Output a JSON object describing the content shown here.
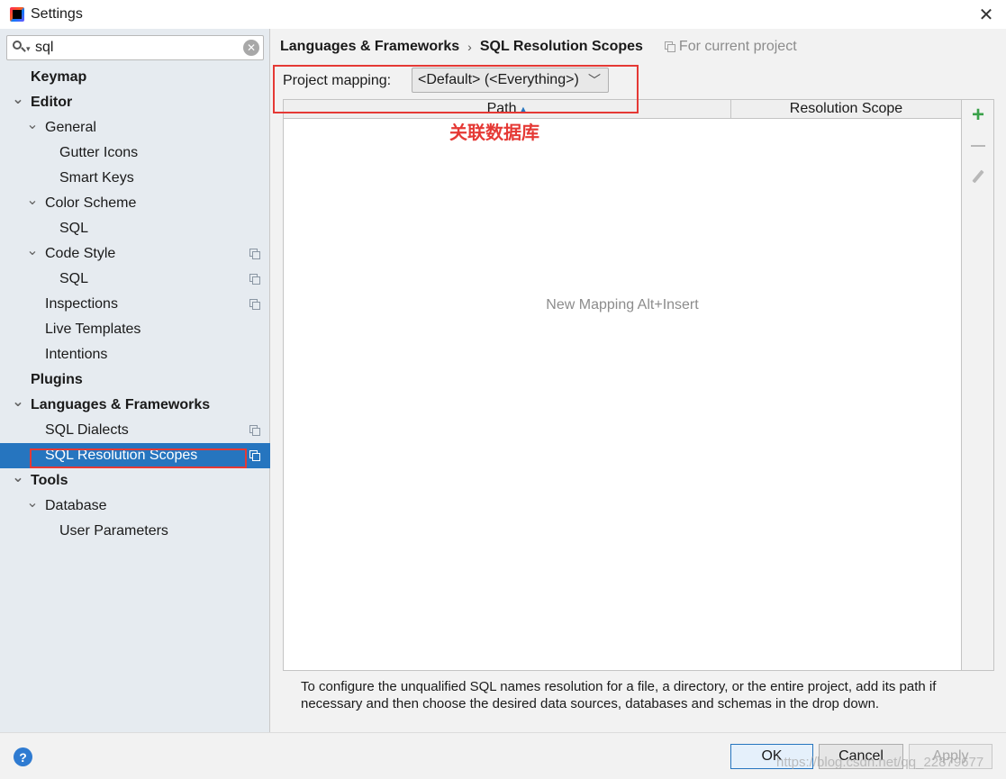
{
  "window": {
    "title": "Settings"
  },
  "search": {
    "value": "sql"
  },
  "tree": [
    {
      "label": "Keymap",
      "bold": true,
      "level": 0,
      "chevron": false,
      "copy": false
    },
    {
      "label": "Editor",
      "bold": true,
      "level": 0,
      "chevron": true,
      "copy": false
    },
    {
      "label": "General",
      "bold": false,
      "level": 1,
      "chevron": true,
      "copy": false
    },
    {
      "label": "Gutter Icons",
      "bold": false,
      "level": 2,
      "chevron": false,
      "copy": false
    },
    {
      "label": "Smart Keys",
      "bold": false,
      "level": 2,
      "chevron": false,
      "copy": false
    },
    {
      "label": "Color Scheme",
      "bold": false,
      "level": 1,
      "chevron": true,
      "copy": false
    },
    {
      "label": "SQL",
      "bold": false,
      "level": 2,
      "chevron": false,
      "copy": false
    },
    {
      "label": "Code Style",
      "bold": false,
      "level": 1,
      "chevron": true,
      "copy": true
    },
    {
      "label": "SQL",
      "bold": false,
      "level": 2,
      "chevron": false,
      "copy": true
    },
    {
      "label": "Inspections",
      "bold": false,
      "level": 1,
      "chevron": false,
      "copy": true
    },
    {
      "label": "Live Templates",
      "bold": false,
      "level": 1,
      "chevron": false,
      "copy": false
    },
    {
      "label": "Intentions",
      "bold": false,
      "level": 1,
      "chevron": false,
      "copy": false
    },
    {
      "label": "Plugins",
      "bold": true,
      "level": 0,
      "chevron": false,
      "copy": false
    },
    {
      "label": "Languages & Frameworks",
      "bold": true,
      "level": 0,
      "chevron": true,
      "copy": false
    },
    {
      "label": "SQL Dialects",
      "bold": false,
      "level": 1,
      "chevron": false,
      "copy": true
    },
    {
      "label": "SQL Resolution Scopes",
      "bold": false,
      "level": 1,
      "chevron": false,
      "copy": true,
      "selected": true
    },
    {
      "label": "Tools",
      "bold": true,
      "level": 0,
      "chevron": true,
      "copy": false
    },
    {
      "label": "Database",
      "bold": false,
      "level": 1,
      "chevron": true,
      "copy": false
    },
    {
      "label": "User Parameters",
      "bold": false,
      "level": 2,
      "chevron": false,
      "copy": false
    }
  ],
  "breadcrumb": {
    "parent": "Languages & Frameworks",
    "separator": "›",
    "current": "SQL Resolution Scopes",
    "scope_note": "For current project"
  },
  "mapping": {
    "label": "Project mapping:",
    "selected": "<Default> (<Everything>)"
  },
  "annotation": "关联数据库",
  "table": {
    "col_path": "Path",
    "col_scope": "Resolution Scope",
    "empty_text": "New Mapping Alt+Insert"
  },
  "toolbar": {
    "add": "+"
  },
  "help_text": "To configure the unqualified SQL names resolution for a file, a directory, or the entire project, add its path if necessary and then choose the desired data sources, databases and schemas in the drop down.",
  "buttons": {
    "help": "?",
    "ok": "OK",
    "cancel": "Cancel",
    "apply": "Apply"
  },
  "watermark": "https://blog.csdn.net/qq_22879677",
  "colors": {
    "selection": "#2675bf",
    "annotation_red": "#e53935",
    "add_green": "#3aa14a",
    "sidebar_bg": "#e6ebf0"
  }
}
